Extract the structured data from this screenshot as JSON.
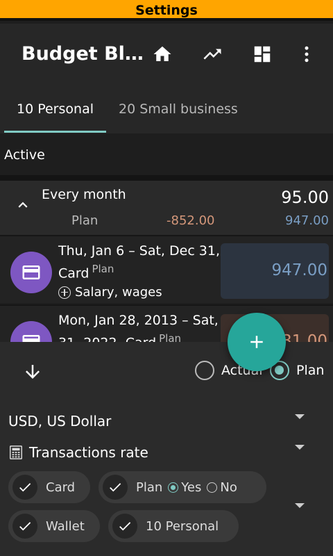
{
  "settings_bar": {
    "label": "Settings"
  },
  "appbar": {
    "title": "Budget Bl…",
    "icons": [
      "home-icon",
      "trending-up-icon",
      "dashboard-icon",
      "more-vert-icon"
    ]
  },
  "tabs": [
    {
      "label": "10 Personal",
      "selected": true
    },
    {
      "label": "20 Small business",
      "selected": false
    }
  ],
  "section": {
    "label": "Active"
  },
  "group": {
    "name": "Every month",
    "amount": "95.00",
    "plan_label": "Plan",
    "plan_negative": "-852.00",
    "plan_positive": "947.00"
  },
  "transactions": [
    {
      "dates": "Thu, Jan 6 – Sat, Dec 31, 2022,",
      "account": "Card",
      "type": "Plan",
      "category": "Salary, wages",
      "amount": "947.00"
    },
    {
      "dates": "Mon, Jan 28, 2013 – Sat, Dec",
      "account": "31, 2022, Card",
      "type": "Plan",
      "amount": "31.00"
    }
  ],
  "panel": {
    "mode_options": [
      {
        "label": "Actual",
        "checked": false
      },
      {
        "label": "Plan",
        "checked": true
      }
    ],
    "currency": "USD, US Dollar",
    "rate_label": "Transactions rate",
    "chips": {
      "card": "Card",
      "plan": "Plan",
      "plan_yes": "Yes",
      "plan_no": "No",
      "wallet": "Wallet",
      "personal": "10 Personal"
    }
  },
  "colors": {
    "accent": "#80cbc4",
    "fab": "#26a69a",
    "avatar": "#7e57c2",
    "settings_bar": "#ffa500",
    "positive_amount": "#7a9ec4",
    "negative_amount": "#d4977a"
  }
}
